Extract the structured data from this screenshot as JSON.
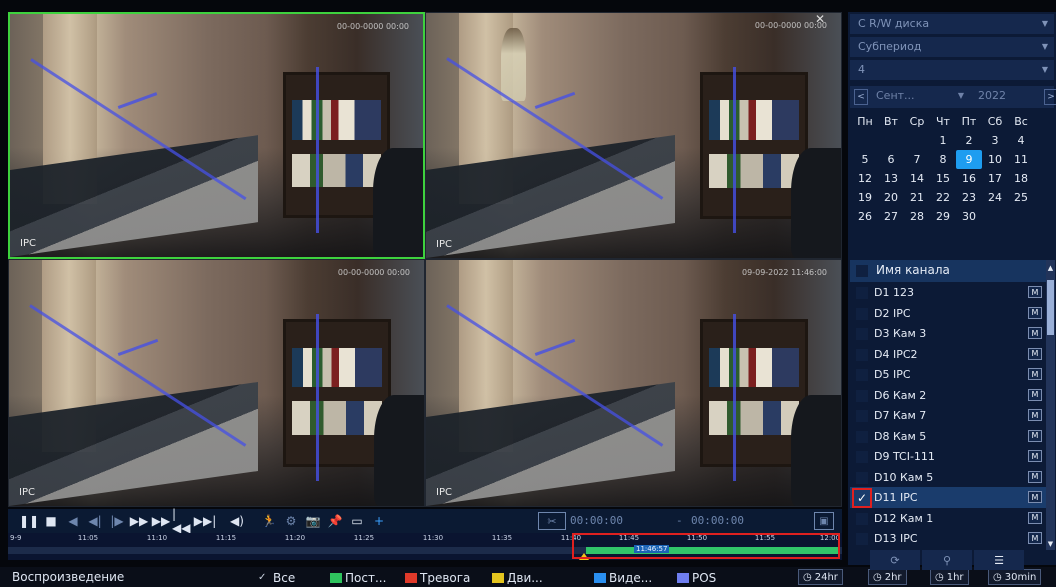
{
  "tiles": [
    {
      "label": "IPC",
      "osd": "00-00-0000 00:00",
      "selected": true
    },
    {
      "label": "IPC",
      "osd": "00-00-0000 00:00",
      "selected": false
    },
    {
      "label": "IPC",
      "osd": "00-00-0000 00:00",
      "selected": false
    },
    {
      "label": "IPC",
      "osd": "09-09-2022 11:46:00",
      "selected": false
    }
  ],
  "controls": {
    "pause": "❚❚",
    "stop": "■",
    "rewind": "◀",
    "prev_frame": "◀|",
    "next_frame": "|▶",
    "slow": "▶▶",
    "fast": "▶▶",
    "prev_record": "|◀◀",
    "next_record": "▶▶|",
    "volume": "◀)",
    "smart": "🏃",
    "scene": "⚙",
    "snapshot": "📷",
    "pin": "📌",
    "tag": "▭",
    "add_tag": "+",
    "clip_icon": "✂",
    "clip_start": "00:00:00",
    "clip_dash": "-",
    "clip_end": "00:00:00",
    "save": "▣"
  },
  "timeline": {
    "date": "9-9",
    "ticks": [
      "11:05",
      "11:10",
      "11:15",
      "11:20",
      "11:25",
      "11:30",
      "11:35",
      "11:40",
      "11:45",
      "11:50",
      "11:55",
      "12:00"
    ],
    "current_time": "11:46:57"
  },
  "legend": {
    "title": "Воспроизведение",
    "items": [
      {
        "label": "Все",
        "color": "",
        "check": "✓"
      },
      {
        "label": "Пост...",
        "color": "#2fc45e",
        "check": ""
      },
      {
        "label": "Тревога",
        "color": "#e03a2a",
        "check": ""
      },
      {
        "label": "Дви...",
        "color": "#e4c51f",
        "check": ""
      },
      {
        "label": "Виде...",
        "color": "#2a8ff0",
        "check": ""
      },
      {
        "label": "POS",
        "color": "#6f7ef0",
        "check": ""
      }
    ],
    "periods": [
      "24hr",
      "2hr",
      "1hr",
      "30min"
    ]
  },
  "side": {
    "combo1": "C R/W диска",
    "combo2": "Субпериод",
    "combo3": "4",
    "month": "Сент...",
    "year": "2022",
    "weekdays": [
      "Пн",
      "Вт",
      "Ср",
      "Чт",
      "Пт",
      "Сб",
      "Вс"
    ],
    "weeks": [
      [
        "",
        "",
        "",
        "1",
        "2",
        "3",
        "4"
      ],
      [
        "5",
        "6",
        "7",
        "8",
        "9",
        "10",
        "11"
      ],
      [
        "12",
        "13",
        "14",
        "15",
        "16",
        "17",
        "18"
      ],
      [
        "19",
        "20",
        "21",
        "22",
        "23",
        "24",
        "25"
      ],
      [
        "26",
        "27",
        "28",
        "29",
        "30",
        "",
        ""
      ]
    ],
    "selected_day": "9",
    "channel_header": "Имя канала",
    "channels": [
      {
        "name": "D1 123",
        "checked": false
      },
      {
        "name": "D2 IPC",
        "checked": false
      },
      {
        "name": "D3 Кам 3",
        "checked": false
      },
      {
        "name": "D4 IPC2",
        "checked": false
      },
      {
        "name": "D5 IPC",
        "checked": false
      },
      {
        "name": "D6 Кам 2",
        "checked": false
      },
      {
        "name": "D7 Кам 7",
        "checked": false
      },
      {
        "name": "D8 Кам 5",
        "checked": false
      },
      {
        "name": "D9 TCI-111",
        "checked": false
      },
      {
        "name": "D10 Кам 5",
        "checked": false
      },
      {
        "name": "D11 IPC",
        "checked": true
      },
      {
        "name": "D12 Кам 1",
        "checked": false
      },
      {
        "name": "D13 IPC",
        "checked": false
      }
    ],
    "m_badge": "M"
  }
}
